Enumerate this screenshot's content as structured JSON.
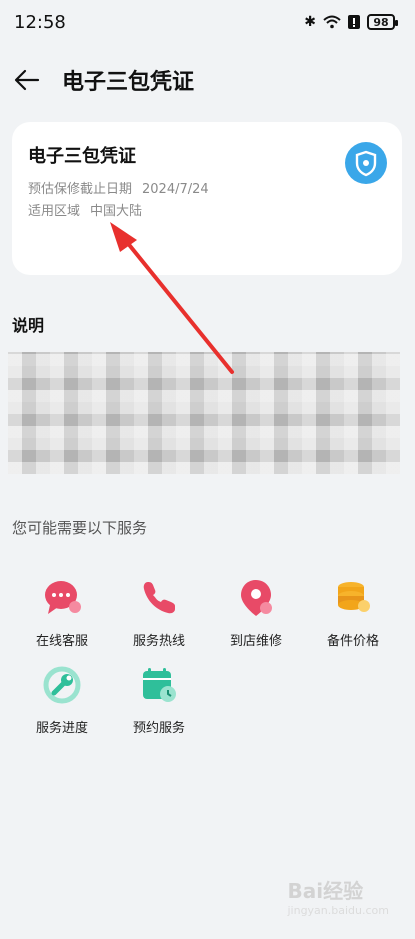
{
  "status": {
    "time": "12:58",
    "battery": "98"
  },
  "appbar": {
    "title": "电子三包凭证"
  },
  "card": {
    "title": "电子三包凭证",
    "warranty_label": "预估保修截止日期",
    "warranty_value": "2024/7/24",
    "region_label": "适用区域",
    "region_value": "中国大陆"
  },
  "desc": {
    "title": "说明"
  },
  "services": {
    "title": "您可能需要以下服务",
    "items": [
      {
        "label": "在线客服",
        "icon": "chat-icon",
        "color": "#e84a67"
      },
      {
        "label": "服务热线",
        "icon": "phone-icon",
        "color": "#e84a67"
      },
      {
        "label": "到店维修",
        "icon": "location-pin-icon",
        "color": "#e84a67"
      },
      {
        "label": "备件价格",
        "icon": "coins-icon",
        "color": "#f2a51a"
      },
      {
        "label": "服务进度",
        "icon": "wrench-icon",
        "color": "#2fbf9a"
      },
      {
        "label": "预约服务",
        "icon": "calendar-clock-icon",
        "color": "#2fbf9a"
      }
    ]
  },
  "watermark": {
    "brand": "Bai经验",
    "url": "jingyan.baidu.com"
  }
}
